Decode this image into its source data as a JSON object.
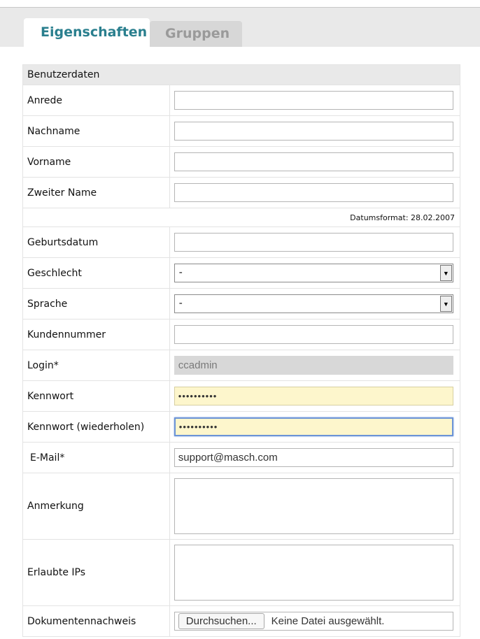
{
  "tabs": {
    "active_label": "Eigenschaften",
    "inactive_label": "Gruppen"
  },
  "section_title": "Benutzerdaten",
  "fields": {
    "anrede": {
      "label": "Anrede",
      "value": ""
    },
    "nachname": {
      "label": "Nachname",
      "value": ""
    },
    "vorname": {
      "label": "Vorname",
      "value": ""
    },
    "zweiter_name": {
      "label": "Zweiter Name",
      "value": ""
    },
    "date_format_note": "Datumsformat: 28.02.2007",
    "geburtsdatum": {
      "label": "Geburtsdatum",
      "value": ""
    },
    "geschlecht": {
      "label": "Geschlecht",
      "selected": "-"
    },
    "sprache": {
      "label": "Sprache",
      "selected": "-"
    },
    "kundennummer": {
      "label": "Kundennummer",
      "value": ""
    },
    "login": {
      "label": "Login*",
      "value": "ccadmin"
    },
    "kennwort": {
      "label": "Kennwort",
      "value": "••••••••••"
    },
    "kennwort_wdh": {
      "label": "Kennwort (wiederholen)",
      "value": "••••••••••"
    },
    "email": {
      "label": "E-Mail*",
      "value": "support@masch.com"
    },
    "anmerkung": {
      "label": "Anmerkung",
      "value": ""
    },
    "erlaubte_ips": {
      "label": "Erlaubte IPs",
      "value": ""
    },
    "dokumentennachweis": {
      "label": "Dokumentennachweis",
      "button_label": "Durchsuchen...",
      "status": "Keine Datei ausgewählt."
    }
  },
  "colors": {
    "tab_active_text": "#2a7f8e",
    "password_bg": "#fdf6cc",
    "focus_border": "#6c94d6"
  },
  "icons": {
    "dropdown": "chevron-down-icon"
  }
}
